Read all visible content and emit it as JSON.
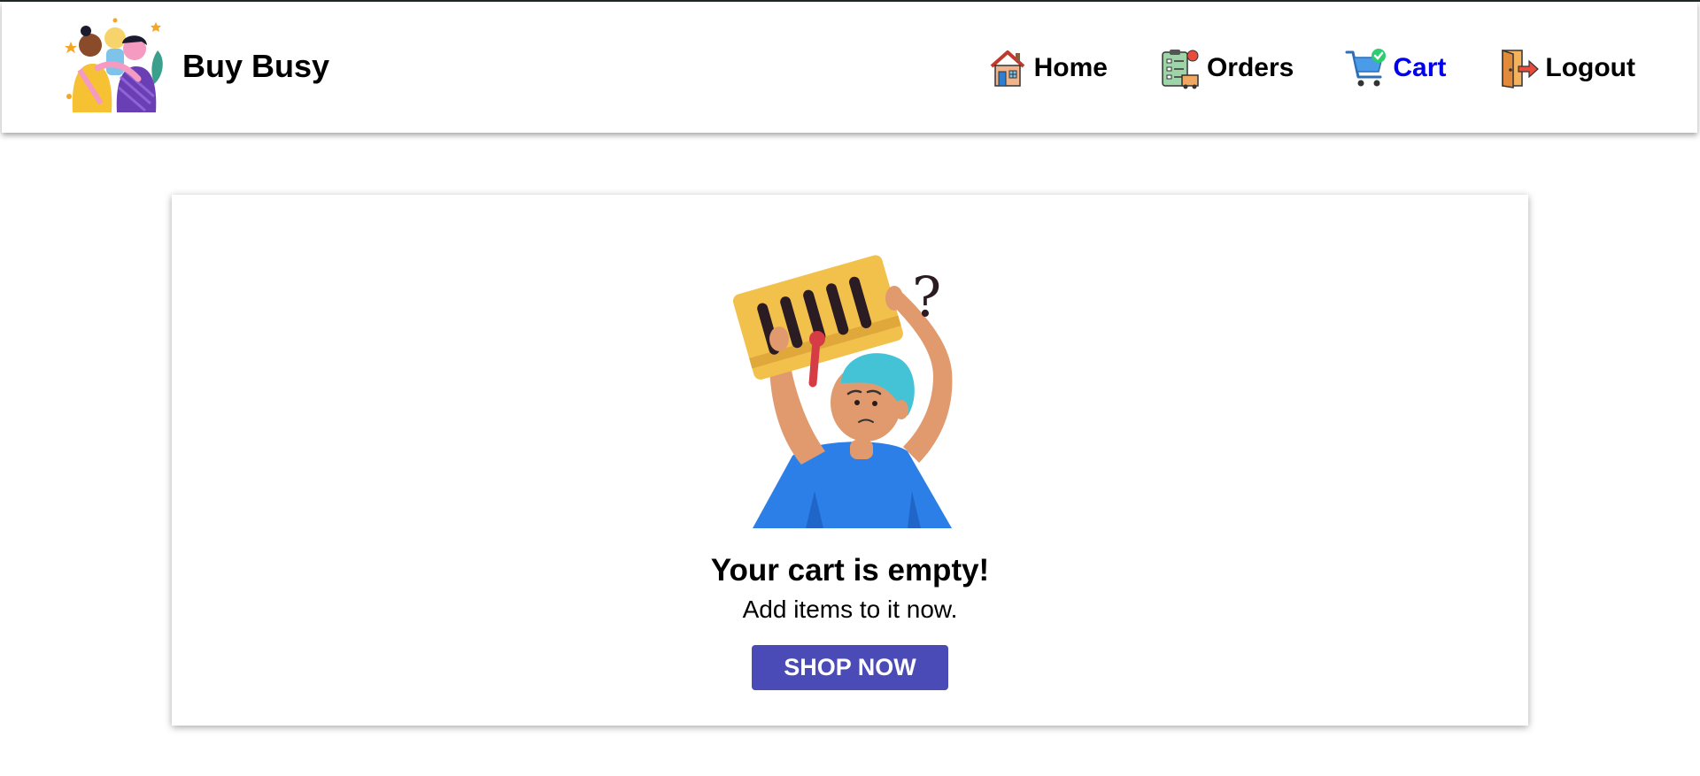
{
  "navbar": {
    "brand_name": "Buy Busy",
    "links": [
      {
        "label": "Home",
        "icon": "home-icon",
        "active": false
      },
      {
        "label": "Orders",
        "icon": "orders-icon",
        "active": false
      },
      {
        "label": "Cart",
        "icon": "cart-icon",
        "active": true
      },
      {
        "label": "Logout",
        "icon": "logout-icon",
        "active": false
      }
    ],
    "active_color": "#0000ee"
  },
  "empty_cart": {
    "title": "Your cart is empty!",
    "subtitle": "Add items to it now.",
    "button_label": "SHOP NOW",
    "button_color": "#4a4bb6"
  }
}
